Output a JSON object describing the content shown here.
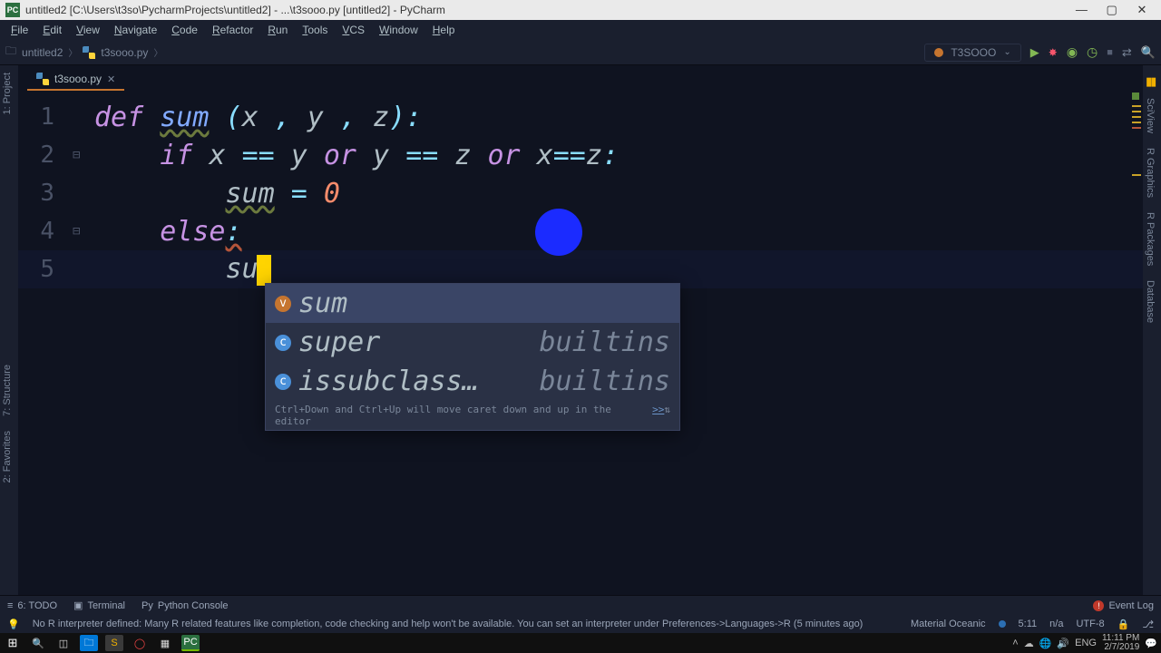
{
  "titlebar": {
    "app_icon_text": "PC",
    "title": "untitled2 [C:\\Users\\t3so\\PycharmProjects\\untitled2] - ...\\t3sooo.py [untitled2] - PyCharm"
  },
  "menubar": [
    "File",
    "Edit",
    "View",
    "Navigate",
    "Code",
    "Refactor",
    "Run",
    "Tools",
    "VCS",
    "Window",
    "Help"
  ],
  "breadcrumb": {
    "project": "untitled2",
    "file": "t3sooo.py"
  },
  "runconfig": {
    "name": "T3SOOO"
  },
  "tabs": [
    {
      "name": "t3sooo.py",
      "active": true
    }
  ],
  "left_tool_windows": [
    "1: Project"
  ],
  "left_tool_windows_lower": [
    "7: Structure",
    "2: Favorites"
  ],
  "right_tool_windows": [
    "SciView",
    "R Graphics",
    "R Packages",
    "Database"
  ],
  "code_lines": [
    {
      "no": "1",
      "fold": "",
      "tokens": [
        {
          "t": "kw",
          "v": "def "
        },
        {
          "t": "fn underline-w",
          "v": "sum"
        },
        {
          "t": "id",
          "v": " "
        },
        {
          "t": "op",
          "v": "("
        },
        {
          "t": "id",
          "v": "x "
        },
        {
          "t": "op",
          "v": ","
        },
        {
          "t": "id",
          "v": " y "
        },
        {
          "t": "op",
          "v": ","
        },
        {
          "t": "id",
          "v": " z"
        },
        {
          "t": "op",
          "v": "):"
        }
      ]
    },
    {
      "no": "2",
      "fold": "⊟",
      "indent": 1,
      "tokens": [
        {
          "t": "kw",
          "v": "if "
        },
        {
          "t": "id",
          "v": "x "
        },
        {
          "t": "op",
          "v": "=="
        },
        {
          "t": "id",
          "v": " y "
        },
        {
          "t": "kw",
          "v": "or"
        },
        {
          "t": "id",
          "v": " y "
        },
        {
          "t": "op",
          "v": "=="
        },
        {
          "t": "id",
          "v": " z "
        },
        {
          "t": "kw",
          "v": "or"
        },
        {
          "t": "id",
          "v": " x"
        },
        {
          "t": "op",
          "v": "=="
        },
        {
          "t": "id",
          "v": "z"
        },
        {
          "t": "op",
          "v": ":"
        }
      ]
    },
    {
      "no": "3",
      "fold": "",
      "indent": 2,
      "tokens": [
        {
          "t": "id underline-w",
          "v": "sum"
        },
        {
          "t": "id",
          "v": " "
        },
        {
          "t": "op",
          "v": "="
        },
        {
          "t": "id",
          "v": " "
        },
        {
          "t": "num",
          "v": "0"
        }
      ]
    },
    {
      "no": "4",
      "fold": "⊟",
      "indent": 1,
      "tokens": [
        {
          "t": "kw",
          "v": "else"
        },
        {
          "t": "op underline-e",
          "v": ":"
        }
      ]
    },
    {
      "no": "5",
      "fold": "",
      "indent": 2,
      "current": true,
      "tokens": [
        {
          "t": "id",
          "v": "su"
        },
        {
          "t": "cursor",
          "v": ""
        }
      ]
    }
  ],
  "autocomplete": {
    "items": [
      {
        "kind": "var",
        "name": "sum",
        "module": "",
        "selected": true
      },
      {
        "kind": "cls",
        "name": "super",
        "module": "builtins"
      },
      {
        "kind": "cls",
        "name": "issubclass…",
        "module": "builtins"
      }
    ],
    "hint_text": "Ctrl+Down and Ctrl+Up will move caret down and up in the editor",
    "hint_link": ">>"
  },
  "bottom_tools": [
    {
      "icon": "≡",
      "label": "6: TODO"
    },
    {
      "icon": "▣",
      "label": "Terminal"
    },
    {
      "icon": "Py",
      "label": "Python Console"
    }
  ],
  "event_log_label": "Event Log",
  "status": {
    "bulb": "💡",
    "message": "No R interpreter defined: Many R related features like completion, code checking and help won't be available. You can set an interpreter under Preferences->Languages->R (5 minutes ago)",
    "theme": "Material Oceanic",
    "pos": "5:11",
    "na": "n/a",
    "encoding": "UTF-8",
    "lock": "🔒"
  },
  "taskbar": {
    "lang": "ENG",
    "time": "11:11 PM",
    "date": "2/7/2019"
  }
}
